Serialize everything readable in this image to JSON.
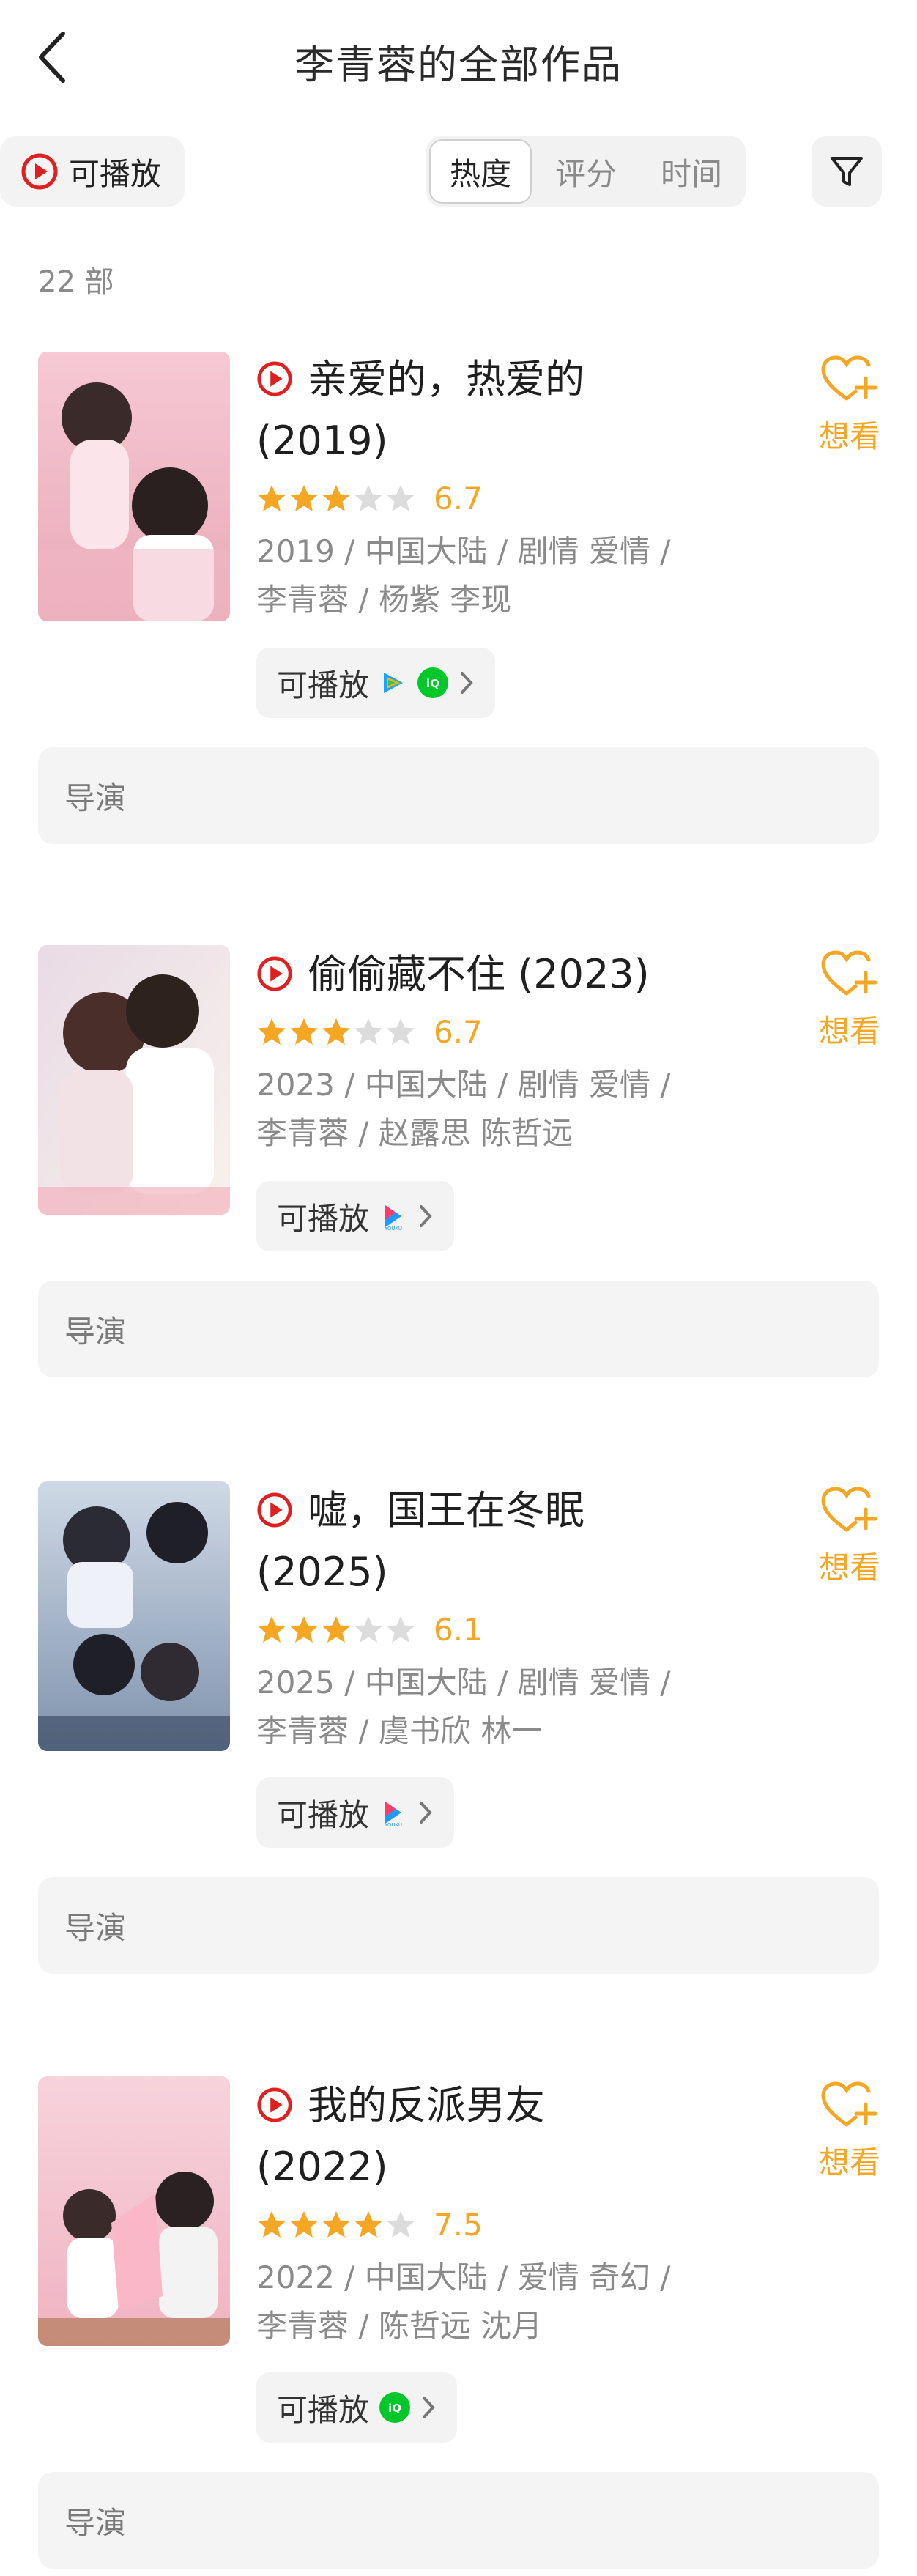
{
  "header": {
    "title": "李青蓉的全部作品"
  },
  "toolbar": {
    "playable_label": "可播放",
    "sort_tabs": [
      "热度",
      "评分",
      "时间"
    ],
    "active_sort": "热度"
  },
  "count_label": "22 部",
  "colors": {
    "accent": "#f5a623",
    "play_red": "#e02020",
    "chip_bg": "#f3f3f3"
  },
  "works": [
    {
      "title_line1": "亲爱的，热爱的",
      "title_line2": "(2019)",
      "rating": "6.7",
      "stars": 3.5,
      "meta_line1": "2019 / 中国大陆 / 剧情 爱情 /",
      "meta_line2": "李青蓉 / 杨紫 李现",
      "source_label": "可播放",
      "sources": [
        "tencent-video-icon",
        "iqiyi-icon"
      ],
      "want_label": "想看",
      "director_label": "导演"
    },
    {
      "title_line1": "偷偷藏不住 (2023)",
      "title_line2": "",
      "rating": "6.7",
      "stars": 3.5,
      "meta_line1": "2023 / 中国大陆 / 剧情 爱情 /",
      "meta_line2": "李青蓉 / 赵露思 陈哲远",
      "source_label": "可播放",
      "sources": [
        "youku-icon"
      ],
      "want_label": "想看",
      "director_label": "导演"
    },
    {
      "title_line1": "嘘，国王在冬眠",
      "title_line2": "(2025)",
      "rating": "6.1",
      "stars": 3,
      "meta_line1": "2025 / 中国大陆 / 剧情 爱情 /",
      "meta_line2": "李青蓉 / 虞书欣 林一",
      "source_label": "可播放",
      "sources": [
        "youku-icon"
      ],
      "want_label": "想看",
      "director_label": "导演"
    },
    {
      "title_line1": "我的反派男友",
      "title_line2": "(2022)",
      "rating": "7.5",
      "stars": 4,
      "meta_line1": "2022 / 中国大陆 / 爱情 奇幻 /",
      "meta_line2": "李青蓉 / 陈哲远 沈月",
      "source_label": "可播放",
      "sources": [
        "iqiyi-icon"
      ],
      "want_label": "想看",
      "director_label": "导演"
    }
  ]
}
